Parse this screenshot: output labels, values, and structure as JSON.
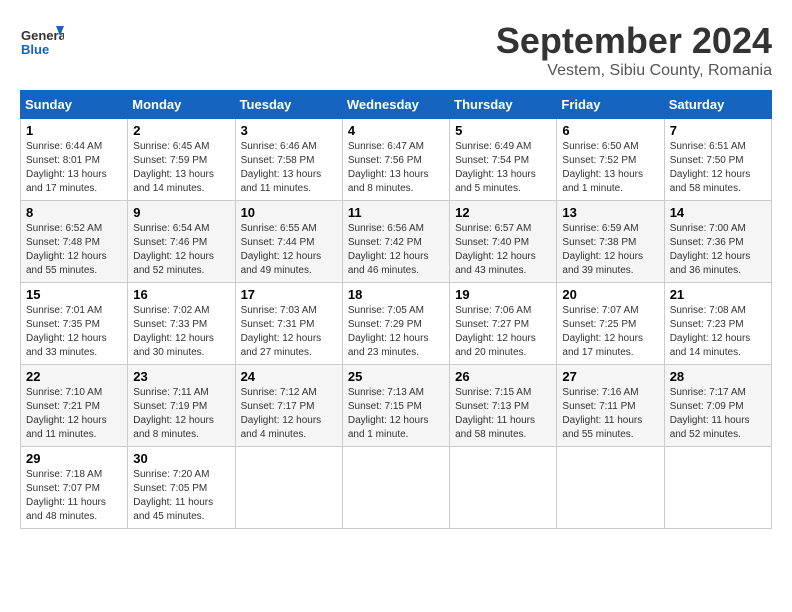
{
  "header": {
    "logo_line1": "General",
    "logo_line2": "Blue",
    "title": "September 2024",
    "subtitle": "Vestem, Sibiu County, Romania"
  },
  "weekdays": [
    "Sunday",
    "Monday",
    "Tuesday",
    "Wednesday",
    "Thursday",
    "Friday",
    "Saturday"
  ],
  "weeks": [
    [
      {
        "day": "1",
        "info": "Sunrise: 6:44 AM\nSunset: 8:01 PM\nDaylight: 13 hours and 17 minutes."
      },
      {
        "day": "2",
        "info": "Sunrise: 6:45 AM\nSunset: 7:59 PM\nDaylight: 13 hours and 14 minutes."
      },
      {
        "day": "3",
        "info": "Sunrise: 6:46 AM\nSunset: 7:58 PM\nDaylight: 13 hours and 11 minutes."
      },
      {
        "day": "4",
        "info": "Sunrise: 6:47 AM\nSunset: 7:56 PM\nDaylight: 13 hours and 8 minutes."
      },
      {
        "day": "5",
        "info": "Sunrise: 6:49 AM\nSunset: 7:54 PM\nDaylight: 13 hours and 5 minutes."
      },
      {
        "day": "6",
        "info": "Sunrise: 6:50 AM\nSunset: 7:52 PM\nDaylight: 13 hours and 1 minute."
      },
      {
        "day": "7",
        "info": "Sunrise: 6:51 AM\nSunset: 7:50 PM\nDaylight: 12 hours and 58 minutes."
      }
    ],
    [
      {
        "day": "8",
        "info": "Sunrise: 6:52 AM\nSunset: 7:48 PM\nDaylight: 12 hours and 55 minutes."
      },
      {
        "day": "9",
        "info": "Sunrise: 6:54 AM\nSunset: 7:46 PM\nDaylight: 12 hours and 52 minutes."
      },
      {
        "day": "10",
        "info": "Sunrise: 6:55 AM\nSunset: 7:44 PM\nDaylight: 12 hours and 49 minutes."
      },
      {
        "day": "11",
        "info": "Sunrise: 6:56 AM\nSunset: 7:42 PM\nDaylight: 12 hours and 46 minutes."
      },
      {
        "day": "12",
        "info": "Sunrise: 6:57 AM\nSunset: 7:40 PM\nDaylight: 12 hours and 43 minutes."
      },
      {
        "day": "13",
        "info": "Sunrise: 6:59 AM\nSunset: 7:38 PM\nDaylight: 12 hours and 39 minutes."
      },
      {
        "day": "14",
        "info": "Sunrise: 7:00 AM\nSunset: 7:36 PM\nDaylight: 12 hours and 36 minutes."
      }
    ],
    [
      {
        "day": "15",
        "info": "Sunrise: 7:01 AM\nSunset: 7:35 PM\nDaylight: 12 hours and 33 minutes."
      },
      {
        "day": "16",
        "info": "Sunrise: 7:02 AM\nSunset: 7:33 PM\nDaylight: 12 hours and 30 minutes."
      },
      {
        "day": "17",
        "info": "Sunrise: 7:03 AM\nSunset: 7:31 PM\nDaylight: 12 hours and 27 minutes."
      },
      {
        "day": "18",
        "info": "Sunrise: 7:05 AM\nSunset: 7:29 PM\nDaylight: 12 hours and 23 minutes."
      },
      {
        "day": "19",
        "info": "Sunrise: 7:06 AM\nSunset: 7:27 PM\nDaylight: 12 hours and 20 minutes."
      },
      {
        "day": "20",
        "info": "Sunrise: 7:07 AM\nSunset: 7:25 PM\nDaylight: 12 hours and 17 minutes."
      },
      {
        "day": "21",
        "info": "Sunrise: 7:08 AM\nSunset: 7:23 PM\nDaylight: 12 hours and 14 minutes."
      }
    ],
    [
      {
        "day": "22",
        "info": "Sunrise: 7:10 AM\nSunset: 7:21 PM\nDaylight: 12 hours and 11 minutes."
      },
      {
        "day": "23",
        "info": "Sunrise: 7:11 AM\nSunset: 7:19 PM\nDaylight: 12 hours and 8 minutes."
      },
      {
        "day": "24",
        "info": "Sunrise: 7:12 AM\nSunset: 7:17 PM\nDaylight: 12 hours and 4 minutes."
      },
      {
        "day": "25",
        "info": "Sunrise: 7:13 AM\nSunset: 7:15 PM\nDaylight: 12 hours and 1 minute."
      },
      {
        "day": "26",
        "info": "Sunrise: 7:15 AM\nSunset: 7:13 PM\nDaylight: 11 hours and 58 minutes."
      },
      {
        "day": "27",
        "info": "Sunrise: 7:16 AM\nSunset: 7:11 PM\nDaylight: 11 hours and 55 minutes."
      },
      {
        "day": "28",
        "info": "Sunrise: 7:17 AM\nSunset: 7:09 PM\nDaylight: 11 hours and 52 minutes."
      }
    ],
    [
      {
        "day": "29",
        "info": "Sunrise: 7:18 AM\nSunset: 7:07 PM\nDaylight: 11 hours and 48 minutes."
      },
      {
        "day": "30",
        "info": "Sunrise: 7:20 AM\nSunset: 7:05 PM\nDaylight: 11 hours and 45 minutes."
      },
      null,
      null,
      null,
      null,
      null
    ]
  ]
}
